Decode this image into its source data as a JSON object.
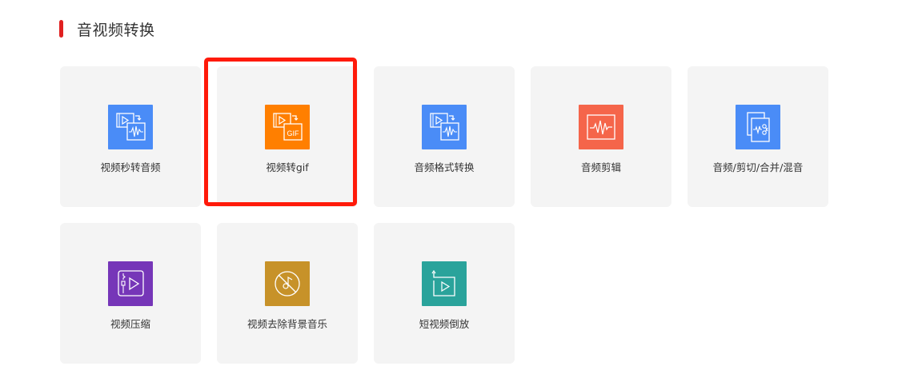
{
  "section": {
    "title": "音视频转换",
    "accent_color": "#e02020"
  },
  "tools": [
    {
      "label": "视频秒转音频",
      "icon": "video-to-audio-icon",
      "color": "#4a8cf7"
    },
    {
      "label": "视频转gif",
      "icon": "video-to-gif-icon",
      "color": "#ff7f00"
    },
    {
      "label": "音频格式转换",
      "icon": "audio-format-convert-icon",
      "color": "#4a8cf7"
    },
    {
      "label": "音频剪辑",
      "icon": "audio-waveform-icon",
      "color": "#f5654a"
    },
    {
      "label": "音频/剪切/合并/混音",
      "icon": "audio-cut-merge-icon",
      "color": "#4a8cf7"
    },
    {
      "label": "视频压缩",
      "icon": "video-compress-icon",
      "color": "#7636b8"
    },
    {
      "label": "视频去除背景音乐",
      "icon": "no-music-icon",
      "color": "#c79229"
    },
    {
      "label": "短视频倒放",
      "icon": "video-reverse-icon",
      "color": "#2aa39b"
    }
  ],
  "highlight": {
    "target": "视频转gif",
    "color": "#ff1a0a"
  }
}
